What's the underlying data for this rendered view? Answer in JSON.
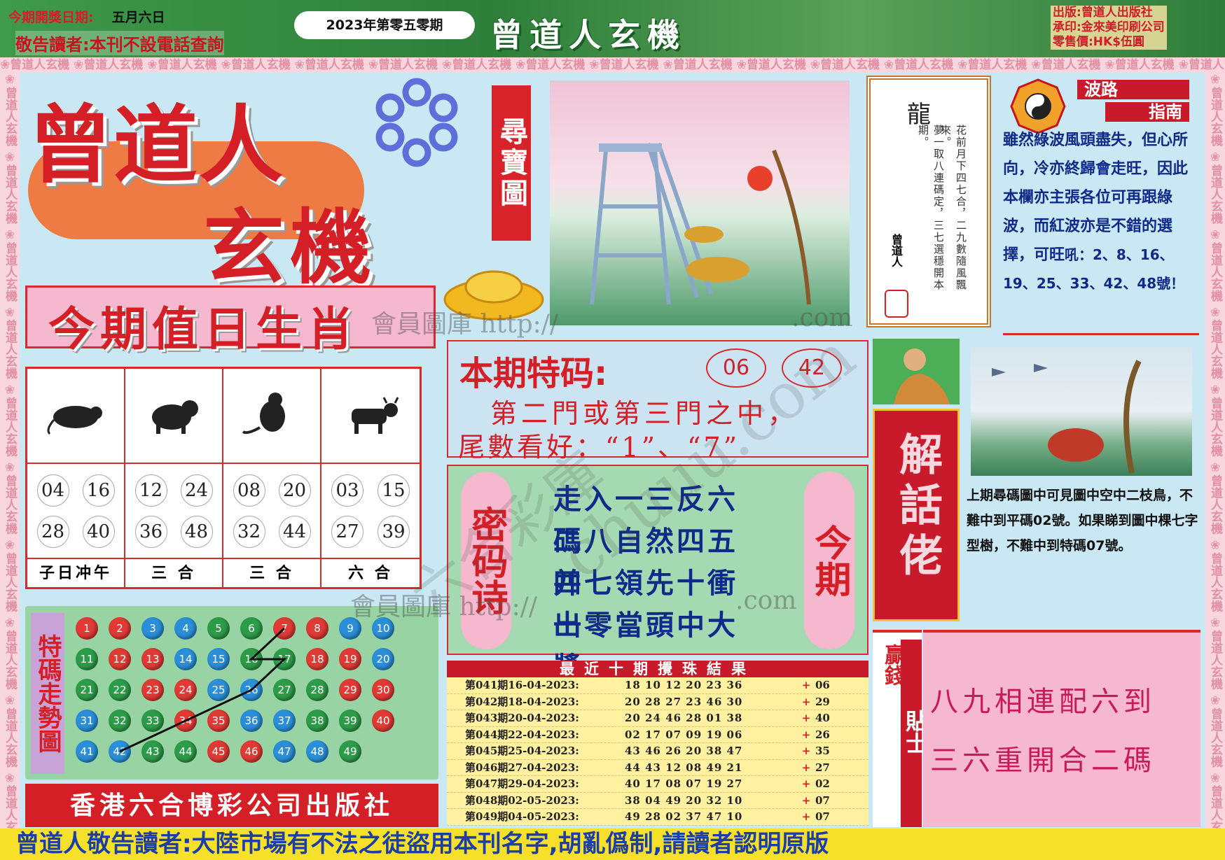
{
  "header": {
    "date_label": "今期開獎日期:",
    "date_value": "五月六日",
    "notice": "敬告讀者:本刊不設電話查詢",
    "issue": "2023年第零五零期",
    "masthead": "曾道人玄機",
    "publisher_lines": [
      "出版:曾道人出版社",
      "承印:金來美印刷公司",
      "零售價:HK$伍圓"
    ]
  },
  "border_text": "曾道人玄機",
  "logo": {
    "line1": "曾道人",
    "line2": "玄機"
  },
  "treasure_map_label": "尋寶圖",
  "hint_card": {
    "char": "龍",
    "verse_right": "花前月下四七合，二九數隨風飄來。",
    "verse_left": "夢一取八連碼定，三七選穩開本期。",
    "author": "曾道人"
  },
  "bolu": {
    "title1": "波路",
    "title2": "指南",
    "text": "雖然綠波風頭盡失，但心所向，冷亦終歸會走旺，因此本欄亦主張各位可再跟綠波，而紅波亦是不錯的選擇，可旺",
    "numbers": "吼：2、8、16、19、25、33、42、48號！"
  },
  "zodiac": {
    "title": "今期值日生肖",
    "columns": [
      {
        "icon": "rat-icon",
        "numbers": [
          "04",
          "16",
          "28",
          "40"
        ],
        "label": "子日冲午"
      },
      {
        "icon": "dog-icon",
        "numbers": [
          "12",
          "24",
          "36",
          "48"
        ],
        "label": "三 合"
      },
      {
        "icon": "monkey-icon",
        "numbers": [
          "08",
          "20",
          "32",
          "44"
        ],
        "label": "三 合"
      },
      {
        "icon": "ox-icon",
        "numbers": [
          "03",
          "15",
          "27",
          "39"
        ],
        "label": "六 合"
      }
    ]
  },
  "special": {
    "label": "本期特码:",
    "numbers": [
      "06",
      "42"
    ],
    "hint_line1": "第二門或第三門之中，",
    "hint_line2": "尾數看好：“1”、“7”"
  },
  "poem": {
    "left_tag": "密码诗",
    "right_tag": "今期",
    "lines": [
      "走入一三反六碼",
      "二八自然四五并",
      "四七領先十衝出",
      "一零當頭中大獎"
    ]
  },
  "trend": {
    "title": "特碼走勢圖",
    "balls": [
      {
        "n": "1",
        "c": "red"
      },
      {
        "n": "2",
        "c": "red"
      },
      {
        "n": "3",
        "c": "blue"
      },
      {
        "n": "4",
        "c": "blue"
      },
      {
        "n": "5",
        "c": "green"
      },
      {
        "n": "6",
        "c": "green"
      },
      {
        "n": "7",
        "c": "red"
      },
      {
        "n": "8",
        "c": "red"
      },
      {
        "n": "9",
        "c": "blue"
      },
      {
        "n": "10",
        "c": "blue"
      },
      {
        "n": "11",
        "c": "green"
      },
      {
        "n": "12",
        "c": "red"
      },
      {
        "n": "13",
        "c": "red"
      },
      {
        "n": "14",
        "c": "blue"
      },
      {
        "n": "15",
        "c": "blue"
      },
      {
        "n": "16",
        "c": "green"
      },
      {
        "n": "17",
        "c": "green"
      },
      {
        "n": "18",
        "c": "red"
      },
      {
        "n": "19",
        "c": "red"
      },
      {
        "n": "20",
        "c": "blue"
      },
      {
        "n": "21",
        "c": "green"
      },
      {
        "n": "22",
        "c": "green"
      },
      {
        "n": "23",
        "c": "red"
      },
      {
        "n": "24",
        "c": "red"
      },
      {
        "n": "25",
        "c": "blue"
      },
      {
        "n": "26",
        "c": "blue"
      },
      {
        "n": "27",
        "c": "green"
      },
      {
        "n": "28",
        "c": "green"
      },
      {
        "n": "29",
        "c": "red"
      },
      {
        "n": "30",
        "c": "red"
      },
      {
        "n": "31",
        "c": "blue"
      },
      {
        "n": "32",
        "c": "green"
      },
      {
        "n": "33",
        "c": "green"
      },
      {
        "n": "34",
        "c": "red"
      },
      {
        "n": "35",
        "c": "red"
      },
      {
        "n": "36",
        "c": "blue"
      },
      {
        "n": "37",
        "c": "blue"
      },
      {
        "n": "38",
        "c": "green"
      },
      {
        "n": "39",
        "c": "green"
      },
      {
        "n": "40",
        "c": "red"
      },
      {
        "n": "41",
        "c": "blue"
      },
      {
        "n": "42",
        "c": "blue"
      },
      {
        "n": "43",
        "c": "green"
      },
      {
        "n": "44",
        "c": "green"
      },
      {
        "n": "45",
        "c": "red"
      },
      {
        "n": "46",
        "c": "red"
      },
      {
        "n": "47",
        "c": "blue"
      },
      {
        "n": "48",
        "c": "blue"
      },
      {
        "n": "49",
        "c": "green"
      }
    ],
    "path_numbers": [
      "42",
      "34",
      "26",
      "17",
      "16",
      "7"
    ]
  },
  "publisher": "香港六合博彩公司出版社",
  "results": {
    "title": "最近十期攪珠結果",
    "rows": [
      {
        "period": "第041期16-04-2023:",
        "nums": "18 10 12 20 23 36",
        "special": "06"
      },
      {
        "period": "第042期18-04-2023:",
        "nums": "20 28 27 23 46 30",
        "special": "29"
      },
      {
        "period": "第043期20-04-2023:",
        "nums": "20 24 46 28 01 38",
        "special": "40"
      },
      {
        "period": "第044期22-04-2023:",
        "nums": "02 17 07 09 19 06",
        "special": "26"
      },
      {
        "period": "第045期25-04-2023:",
        "nums": "43 46 26 20 38 47",
        "special": "35"
      },
      {
        "period": "第046期27-04-2023:",
        "nums": "44 43 12 08 49 21",
        "special": "27"
      },
      {
        "period": "第047期29-04-2023:",
        "nums": "40 17 08 07 19 27",
        "special": "02"
      },
      {
        "period": "第048期02-05-2023:",
        "nums": "38 04 49 20 32 10",
        "special": "07"
      },
      {
        "period": "第049期04-05-2023:",
        "nums": "49 28 02 37 47 10",
        "special": "07"
      }
    ]
  },
  "jiehua": "解話佬",
  "last_period_text": "上期尋碼圖中可見圖中空中二枝鳥，不難中到平碼02號。如果睇到圖中棵七字型樹，不難中到特碼07號。",
  "tips": {
    "tag_a": "贏錢",
    "tag_b": "貼士",
    "line1": "八九相連配六到",
    "line2": "三六重開合二碼"
  },
  "watermark": {
    "site1": "會員圖庫 http://",
    "site2": ".com",
    "url": "chuuu.com",
    "caihe": "六合彩庫"
  },
  "footer": "曾道人敬告讀者:大陸市場有不法之徒盜用本刊名字,胡亂僞制,請讀者認明原版",
  "colors": {
    "red": "#d41f26",
    "blue": "#102a8a",
    "green": "#2d9c48",
    "pink": "#f6b8cf",
    "yellow": "#f7e02a"
  }
}
